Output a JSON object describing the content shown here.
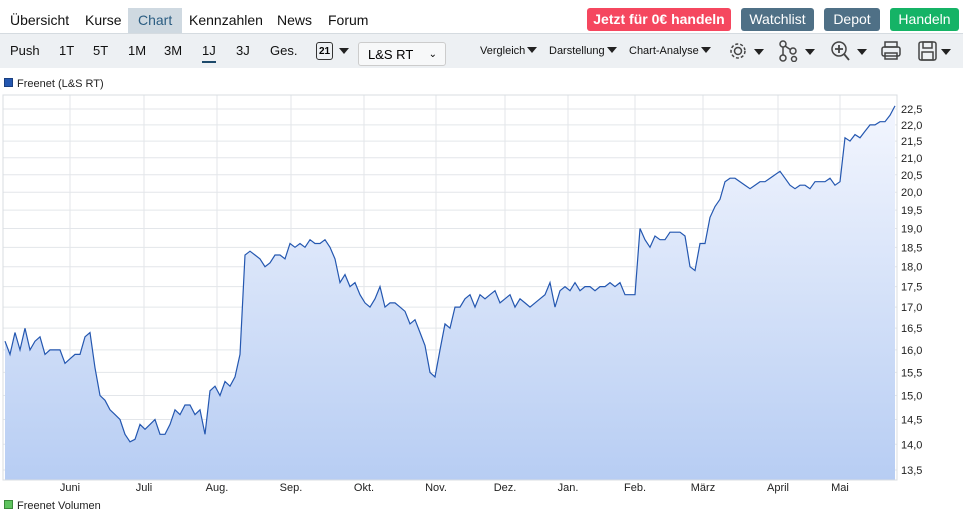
{
  "nav": {
    "tabs": [
      "Übersicht",
      "Kurse",
      "Chart",
      "Kennzahlen",
      "News",
      "Forum"
    ],
    "active": "Chart"
  },
  "buttons": {
    "trade_free": "Jetzt für 0€ handeln",
    "watchlist": "Watchlist",
    "depot": "Depot",
    "handeln": "Handeln"
  },
  "colors": {
    "trade_free": "#f5475f",
    "watchlist": "#4f7086",
    "depot": "#4f7086",
    "handeln": "#15b366",
    "line": "#2457b0"
  },
  "toolbar": {
    "ranges": [
      "Push",
      "1T",
      "5T",
      "1M",
      "3M",
      "1J",
      "3J",
      "Ges."
    ],
    "active_range": "1J",
    "calendar_day": "21",
    "exchange": "L&S RT",
    "vergleich": "Vergleich",
    "darstellung": "Darstellung",
    "analyse": "Chart-Analyse"
  },
  "legend": {
    "series": "Freenet (L&S RT)",
    "volume": "Freenet Volumen"
  },
  "chart_data": {
    "type": "area",
    "scale": "log",
    "ylim": [
      13.3,
      22.9
    ],
    "y_ticks": [
      "22,5",
      "22,0",
      "21,5",
      "21,0",
      "20,5",
      "20,0",
      "19,5",
      "19,0",
      "18,5",
      "18,0",
      "17,5",
      "17,0",
      "16,5",
      "16,0",
      "15,5",
      "15,0",
      "14,5",
      "14,0",
      "13,5"
    ],
    "x_ticks": [
      "Juni",
      "Juli",
      "Aug.",
      "Sep.",
      "Okt.",
      "Nov.",
      "Dez.",
      "Jan.",
      "Feb.",
      "März",
      "April",
      "Mai"
    ],
    "values": [
      16.2,
      15.9,
      16.4,
      16.0,
      16.5,
      16.0,
      16.2,
      16.3,
      15.9,
      16.0,
      16.0,
      16.0,
      15.7,
      15.8,
      15.9,
      15.9,
      16.3,
      16.4,
      15.6,
      15.0,
      14.9,
      14.7,
      14.6,
      14.5,
      14.2,
      14.05,
      14.1,
      14.4,
      14.3,
      14.4,
      14.5,
      14.2,
      14.2,
      14.4,
      14.7,
      14.6,
      14.8,
      14.8,
      14.6,
      14.7,
      14.2,
      15.1,
      15.2,
      15.0,
      15.3,
      15.2,
      15.4,
      15.9,
      18.3,
      18.4,
      18.3,
      18.2,
      18.0,
      18.1,
      18.3,
      18.3,
      18.2,
      18.6,
      18.5,
      18.6,
      18.5,
      18.7,
      18.6,
      18.6,
      18.7,
      18.5,
      18.2,
      17.6,
      17.8,
      17.5,
      17.6,
      17.3,
      17.1,
      17.0,
      17.2,
      17.5,
      17.0,
      17.1,
      17.1,
      17.0,
      16.9,
      16.6,
      16.7,
      16.4,
      16.1,
      15.5,
      15.4,
      16.0,
      16.6,
      16.5,
      17.0,
      17.0,
      17.2,
      17.3,
      17.0,
      17.3,
      17.2,
      17.3,
      17.4,
      17.1,
      17.2,
      17.3,
      17.0,
      17.2,
      17.1,
      17.0,
      17.1,
      17.2,
      17.3,
      17.6,
      17.0,
      17.4,
      17.5,
      17.4,
      17.6,
      17.4,
      17.5,
      17.5,
      17.4,
      17.5,
      17.5,
      17.6,
      17.5,
      17.6,
      17.3,
      17.3,
      17.3,
      19.0,
      18.7,
      18.5,
      18.8,
      18.7,
      18.7,
      18.9,
      18.9,
      18.9,
      18.8,
      18.0,
      17.9,
      18.6,
      18.6,
      19.3,
      19.6,
      19.8,
      20.3,
      20.4,
      20.4,
      20.3,
      20.2,
      20.1,
      20.2,
      20.3,
      20.3,
      20.4,
      20.5,
      20.6,
      20.4,
      20.2,
      20.1,
      20.2,
      20.2,
      20.1,
      20.3,
      20.3,
      20.3,
      20.4,
      20.2,
      20.3,
      21.6,
      21.5,
      21.7,
      21.6,
      21.8,
      22.0,
      22.0,
      22.1,
      22.1,
      22.3,
      22.6
    ]
  }
}
